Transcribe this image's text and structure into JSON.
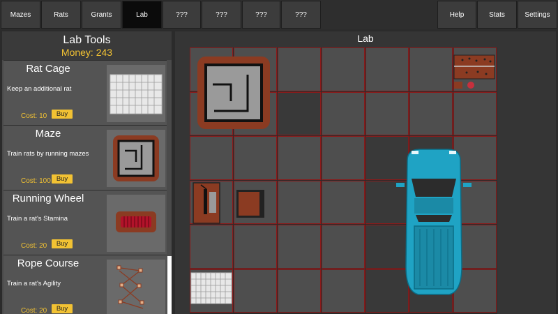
{
  "nav": {
    "tabs": [
      {
        "label": "Mazes"
      },
      {
        "label": "Rats"
      },
      {
        "label": "Grants"
      },
      {
        "label": "Lab"
      },
      {
        "label": "???"
      },
      {
        "label": "???"
      },
      {
        "label": "???"
      },
      {
        "label": "???"
      }
    ],
    "right_tabs": [
      {
        "label": "Help"
      },
      {
        "label": "Stats"
      },
      {
        "label": "Settings"
      }
    ]
  },
  "tools": {
    "title": "Lab Tools",
    "money": "Money: 243",
    "items": [
      {
        "name": "Rat Cage",
        "desc": "Keep an additional rat",
        "cost": "Cost: 10",
        "buy": "Buy"
      },
      {
        "name": "Maze",
        "desc": "Train rats by running mazes",
        "cost": "Cost: 100",
        "buy": "Buy"
      },
      {
        "name": "Running Wheel",
        "desc": "Train a rat's Stamina",
        "cost": "Cost: 20",
        "buy": "Buy"
      },
      {
        "name": "Rope Course",
        "desc": "Train a rat's Agility",
        "cost": "Cost: 20",
        "buy": "Buy"
      }
    ]
  },
  "lab": {
    "title": "Lab",
    "grid_cols": 7,
    "grid_rows": 6,
    "colors": {
      "grid_line": "#8b1a1a",
      "cell": "#4e4e4e",
      "truck": "#1fa3c4",
      "accent": "#f2c233"
    }
  }
}
